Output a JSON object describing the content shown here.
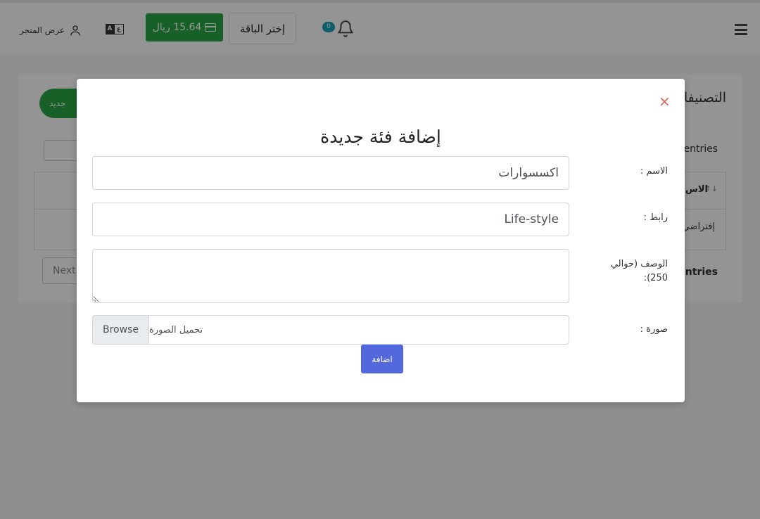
{
  "navbar": {
    "notification_count": "0",
    "plan_button_label": "إختر الباقة",
    "balance_label": "15.64 ريال",
    "language_toggle": [
      "A",
      "ع"
    ],
    "view_store_label": "عرض المتجر",
    "icons": [
      "menu-icon",
      "bell-icon",
      "credit-card-icon",
      "language-icon",
      "user-icon"
    ]
  },
  "background_page": {
    "title_fragment": "التصنيفا",
    "add_button_fragment": "جديد",
    "entries_top": "entries",
    "entries_bottom": "entries",
    "column_header_fragment": "الاس",
    "sort_glyph": "↑↓",
    "cell_fragment": "إفتراضي",
    "next_button": "Next"
  },
  "modal": {
    "close_glyph": "×",
    "title": "إضافة فئة جديدة",
    "fields": {
      "name": {
        "label": "الاسم :",
        "value": "اكسسوارات"
      },
      "slug": {
        "label": "رابط :",
        "value": "Life-style"
      },
      "description": {
        "label_line1": "الوصف (حوالي",
        "label_line2": "250):",
        "value": ""
      },
      "image": {
        "label": "صورة :",
        "file_placeholder": "تحميل الصورة",
        "browse_label": "Browse"
      }
    },
    "submit_label": "اضافة"
  },
  "colors": {
    "success_green": "#28a745",
    "primary_blue": "#5468de",
    "close_red": "#e4604e",
    "badge_teal": "#17a2b8"
  }
}
